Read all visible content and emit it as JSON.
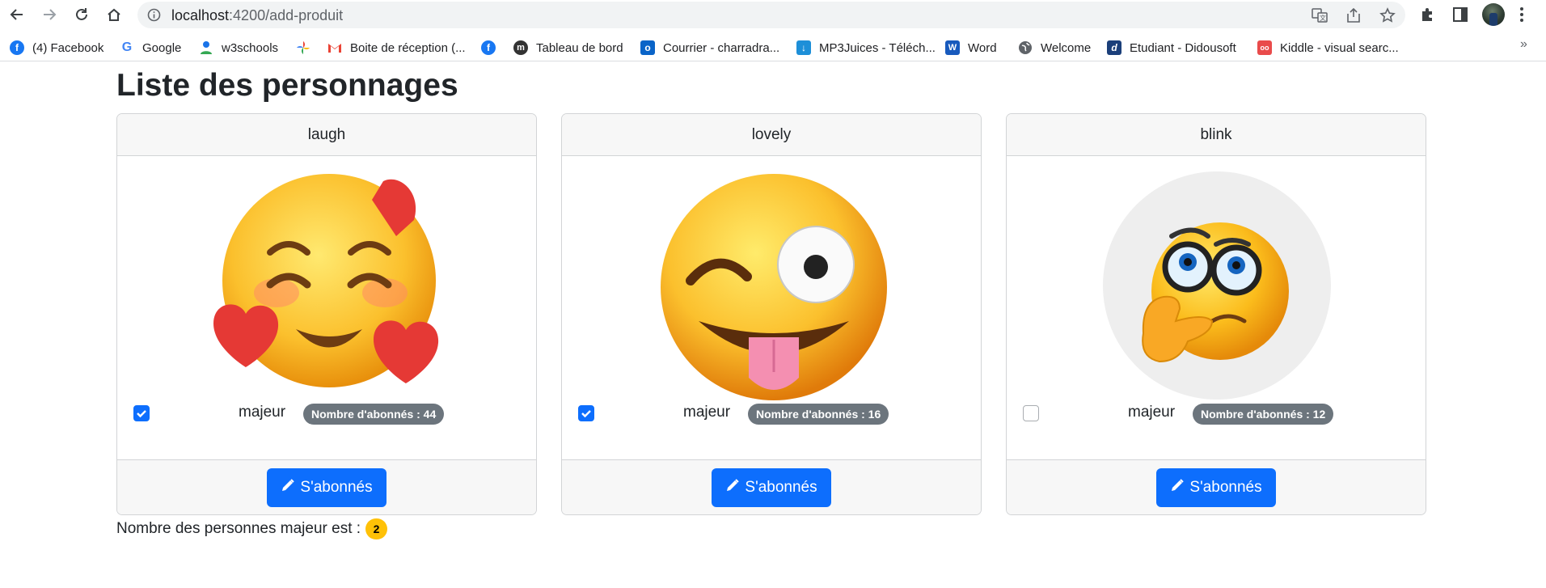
{
  "browser": {
    "url_host": "localhost",
    "url_path": ":4200/add-produit",
    "bookmarks": [
      {
        "label": "(4) Facebook",
        "icon": "facebook-icon"
      },
      {
        "label": "Google",
        "icon": "google-icon"
      },
      {
        "label": "w3schools",
        "icon": "person-icon"
      },
      {
        "label": "",
        "icon": "pinwheel-icon"
      },
      {
        "label": "Boite de réception (...",
        "icon": "gmail-icon"
      },
      {
        "label": "",
        "icon": "facebook-icon"
      },
      {
        "label": "Tableau de bord",
        "icon": "moodle-icon"
      },
      {
        "label": "Courrier - charradra...",
        "icon": "outlook-icon"
      },
      {
        "label": "MP3Juices - Téléch...",
        "icon": "download-icon"
      },
      {
        "label": "Word",
        "icon": "word-icon"
      },
      {
        "label": "Welcome",
        "icon": "globe-icon"
      },
      {
        "label": "Etudiant - Didousoft",
        "icon": "didousoft-icon"
      },
      {
        "label": "Kiddle - visual searc...",
        "icon": "kiddle-icon"
      }
    ],
    "more": "»"
  },
  "page": {
    "title": "Liste des personnages",
    "summary_label": "Nombre des personnes majeur est :",
    "summary_count": "2"
  },
  "cards": [
    {
      "name": "laugh",
      "majeur_label": "majeur",
      "checked": true,
      "badge": "Nombre d'abonnés : 44",
      "button": "S'abonnés",
      "emoji": "smiling-face-with-hearts"
    },
    {
      "name": "lovely",
      "majeur_label": "majeur",
      "checked": true,
      "badge": "Nombre d'abonnés : 16",
      "button": "S'abonnés",
      "emoji": "winking-face-with-tongue"
    },
    {
      "name": "blink",
      "majeur_label": "majeur",
      "checked": false,
      "badge": "Nombre d'abonnés : 12",
      "button": "S'abonnés",
      "emoji": "thinking-face-with-glasses"
    }
  ],
  "colors": {
    "primary": "#0d6efd",
    "badge_secondary": "#6c757d",
    "badge_warning": "#ffc107"
  }
}
